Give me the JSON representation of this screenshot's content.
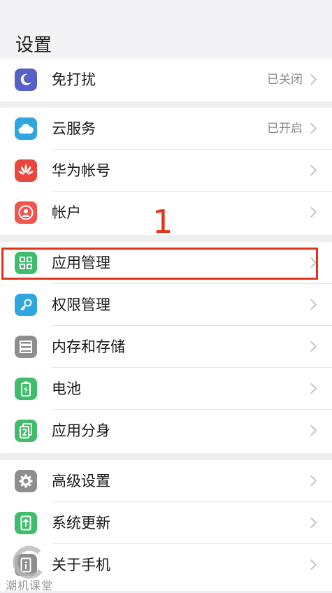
{
  "header": {
    "title": "设置"
  },
  "groups": [
    {
      "items": [
        {
          "label": "免打扰",
          "value": "已关闭",
          "icon": "moon-icon",
          "color": "#5660c7"
        }
      ]
    },
    {
      "items": [
        {
          "label": "云服务",
          "value": "已开启",
          "icon": "cloud-icon",
          "color": "#2fa6df"
        },
        {
          "label": "华为帐号",
          "value": "",
          "icon": "huawei-logo-icon",
          "color": "#e9473d"
        },
        {
          "label": "帐户",
          "value": "",
          "icon": "account-icon",
          "color": "#f0554f"
        }
      ]
    },
    {
      "items": [
        {
          "label": "应用管理",
          "value": "",
          "icon": "app-grid-icon",
          "color": "#3fbd6a"
        },
        {
          "label": "权限管理",
          "value": "",
          "icon": "key-icon",
          "color": "#2fa6df"
        },
        {
          "label": "内存和存储",
          "value": "",
          "icon": "storage-icon",
          "color": "#8e8e8e"
        },
        {
          "label": "电池",
          "value": "",
          "icon": "battery-icon",
          "color": "#3fbd6a"
        },
        {
          "label": "应用分身",
          "value": "",
          "icon": "app-twin-icon",
          "color": "#3fbd6a"
        }
      ]
    },
    {
      "items": [
        {
          "label": "高级设置",
          "value": "",
          "icon": "gear-icon",
          "color": "#8e8e8e"
        },
        {
          "label": "系统更新",
          "value": "",
          "icon": "system-update-icon",
          "color": "#3fbd6a"
        },
        {
          "label": "关于手机",
          "value": "",
          "icon": "phone-info-icon",
          "color": "#8e8e8e"
        }
      ]
    }
  ],
  "annotation": {
    "step_number": "1"
  },
  "watermark": {
    "text": "潮机课堂"
  }
}
